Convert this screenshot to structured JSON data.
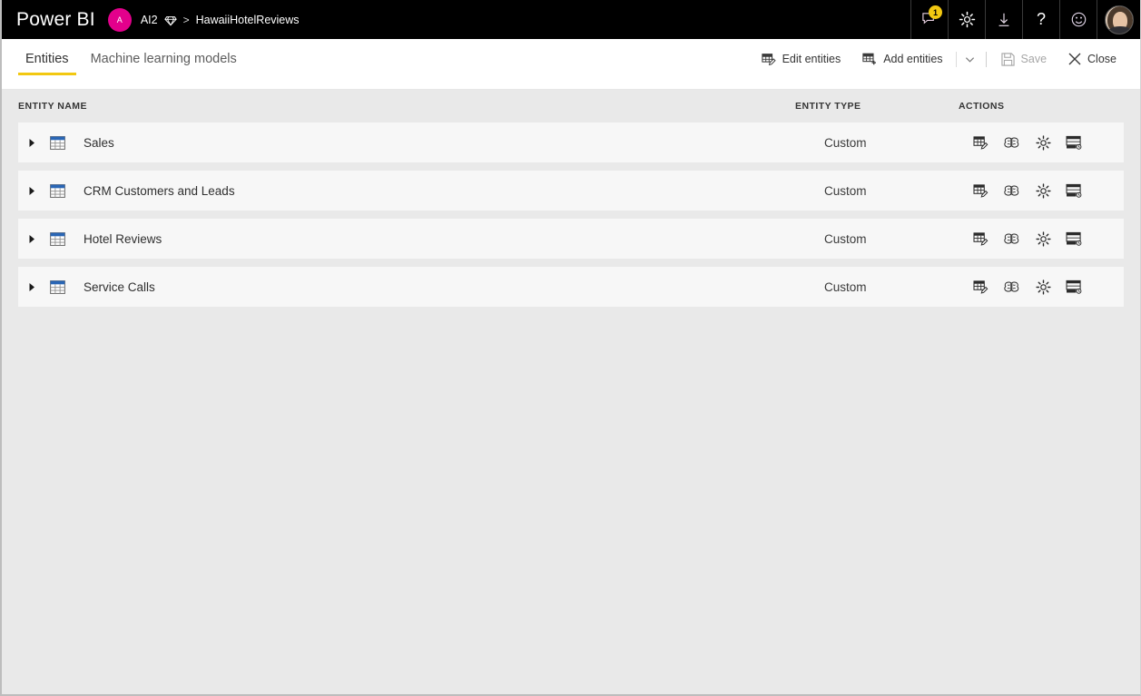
{
  "topbar": {
    "brand": "Power BI",
    "workspace_initial": "A",
    "workspace": "AI2",
    "premium_icon": "diamond-icon",
    "separator": ">",
    "dataflow_name": "HawaiiHotelReviews",
    "notifications_icon": "notifications-icon",
    "notifications_count": "1",
    "settings_icon": "gear-icon",
    "download_icon": "download-icon",
    "help_icon": "help-icon",
    "feedback_icon": "smiley-icon",
    "account_icon": "user-avatar"
  },
  "tabs": [
    {
      "label": "Entities",
      "active": true
    },
    {
      "label": "Machine learning models",
      "active": false
    }
  ],
  "commands": {
    "edit_entities": "Edit entities",
    "add_entities": "Add entities",
    "add_entities_chevron": "chevron-down-icon",
    "save": "Save",
    "close": "Close"
  },
  "table": {
    "headers": {
      "name": "ENTITY NAME",
      "type": "ENTITY TYPE",
      "actions": "ACTIONS"
    },
    "action_icons": [
      "edit-entity-icon",
      "ai-insights-brain-icon",
      "settings-gear-icon",
      "incremental-refresh-icon"
    ],
    "rows": [
      {
        "name": "Sales",
        "type": "Custom"
      },
      {
        "name": "CRM Customers and Leads",
        "type": "Custom"
      },
      {
        "name": "Hotel Reviews",
        "type": "Custom"
      },
      {
        "name": "Service Calls",
        "type": "Custom"
      }
    ]
  },
  "colors": {
    "topbar_bg": "#000000",
    "accent_yellow": "#f2c811",
    "workspace_pink": "#e3008c",
    "page_bg": "#e9e9e9",
    "row_bg": "#f7f7f7"
  }
}
